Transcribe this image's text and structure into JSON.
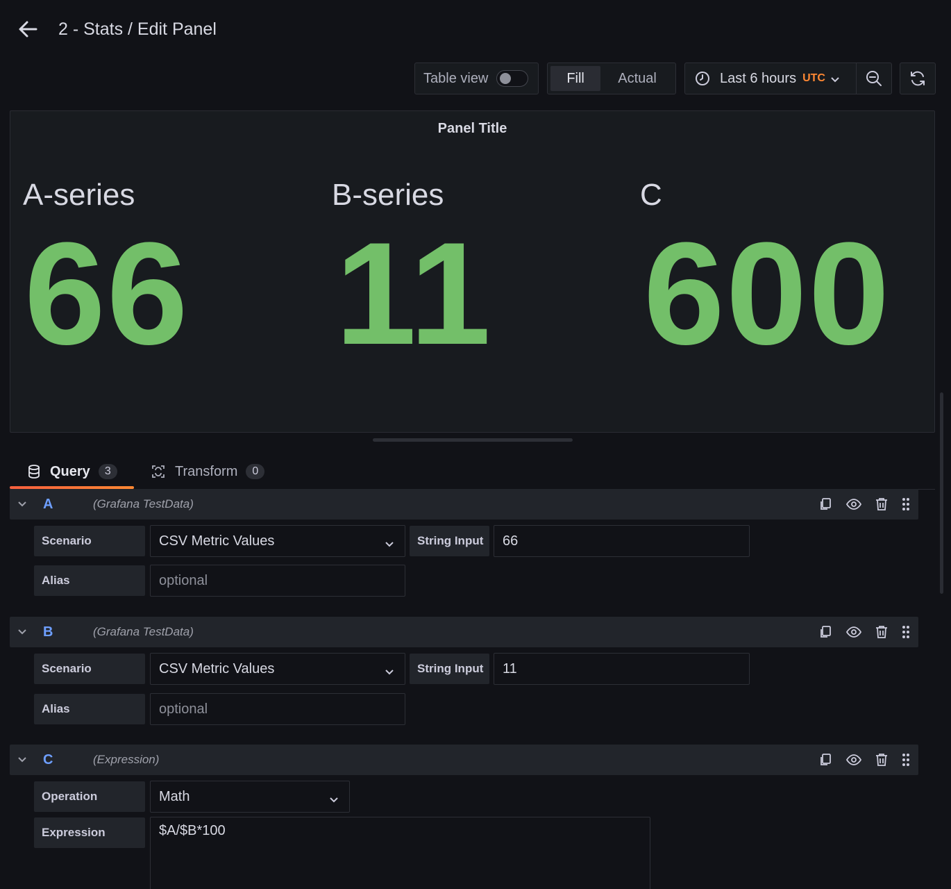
{
  "header": {
    "title": "2 - Stats / Edit Panel"
  },
  "toolbar": {
    "table_view_label": "Table view",
    "table_view_on": false,
    "fill_label": "Fill",
    "actual_label": "Actual",
    "time_range": "Last 6 hours",
    "timezone": "UTC"
  },
  "panel": {
    "title": "Panel Title",
    "stats": [
      {
        "name": "A-series",
        "value": "66"
      },
      {
        "name": "B-series",
        "value": "11"
      },
      {
        "name": "C",
        "value": "600"
      }
    ],
    "value_color": "#73bf69"
  },
  "tabs": [
    {
      "label": "Query",
      "count": "3"
    },
    {
      "label": "Transform",
      "count": "0"
    }
  ],
  "queries": [
    {
      "ref_id": "A",
      "datasource": "(Grafana TestData)",
      "scenario_label": "Scenario",
      "scenario_value": "CSV Metric Values",
      "string_input_label": "String Input",
      "string_input_value": "66",
      "alias_label": "Alias",
      "alias_placeholder": "optional"
    },
    {
      "ref_id": "B",
      "datasource": "(Grafana TestData)",
      "scenario_label": "Scenario",
      "scenario_value": "CSV Metric Values",
      "string_input_label": "String Input",
      "string_input_value": "11",
      "alias_label": "Alias",
      "alias_placeholder": "optional"
    },
    {
      "ref_id": "C",
      "datasource": "(Expression)",
      "operation_label": "Operation",
      "operation_value": "Math",
      "expression_label": "Expression",
      "expression_value": "$A/$B*100"
    }
  ],
  "icons": {
    "back": "arrow-left-icon",
    "clock": "clock-icon",
    "zoom_out": "zoom-out-icon",
    "refresh": "refresh-icon",
    "database": "database-icon",
    "transform": "transform-icon",
    "duplicate": "copy-icon",
    "toggle_visibility": "eye-icon",
    "delete": "trash-icon",
    "drag": "drag-handle-icon"
  }
}
